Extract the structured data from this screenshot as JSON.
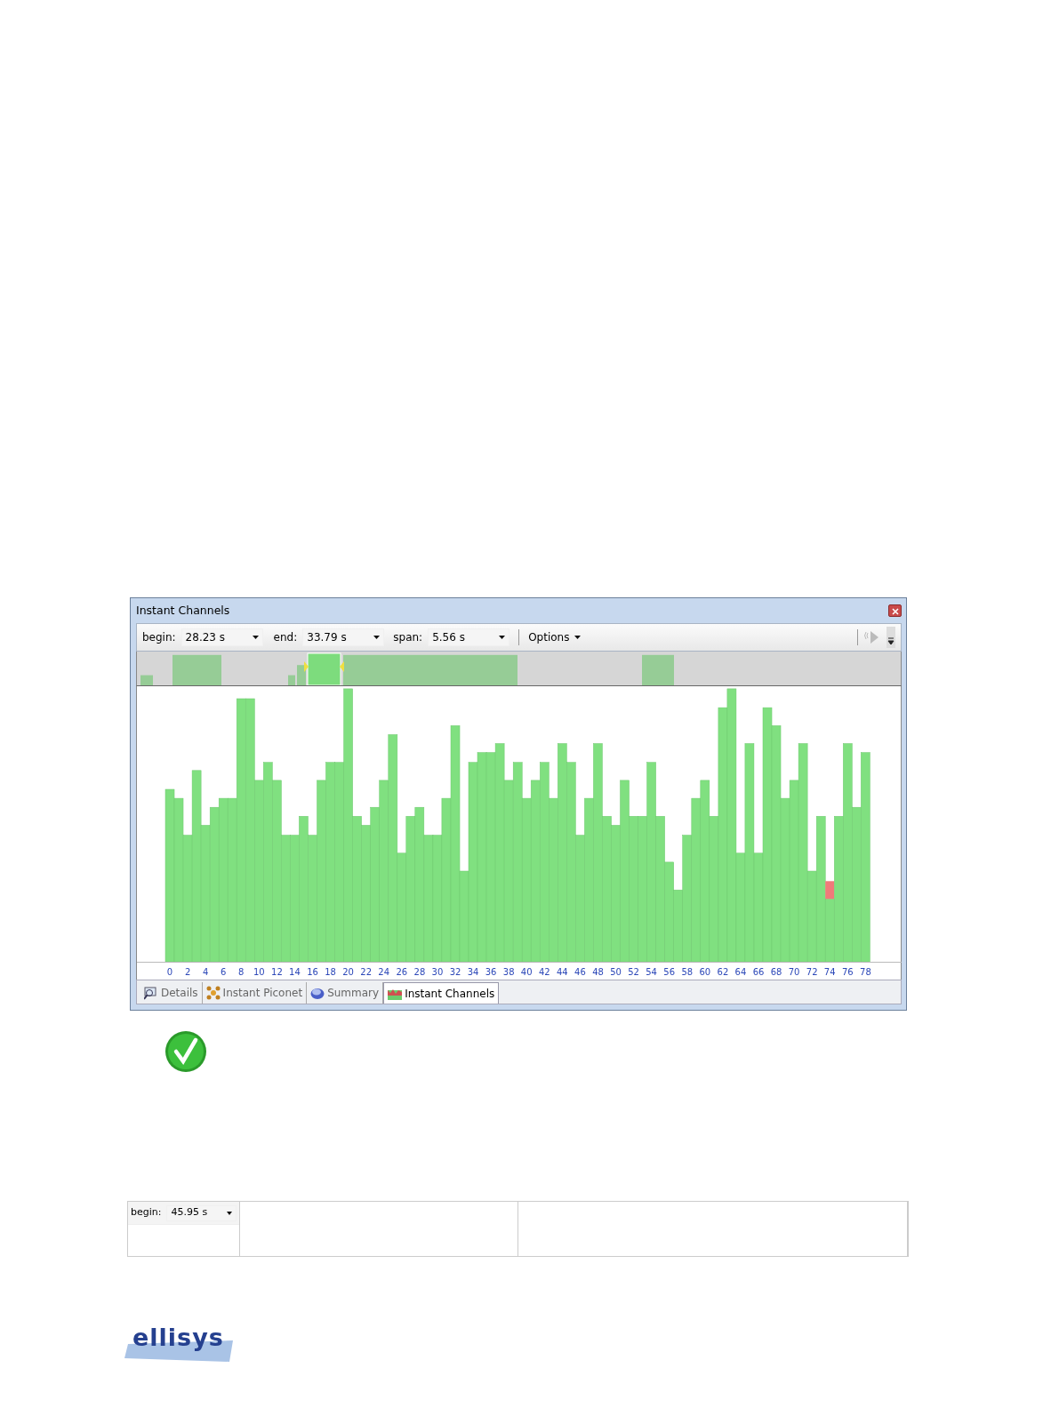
{
  "window": {
    "title": "Instant Channels"
  },
  "toolbar": {
    "fields": [
      {
        "label": "begin:",
        "value": "28.23 s"
      },
      {
        "label": "end:",
        "value": "33.79 s"
      },
      {
        "label": "span:",
        "value": "5.56 s"
      }
    ],
    "options": "Options"
  },
  "chart": {
    "channel_labels": [
      "0",
      "2",
      "4",
      "6",
      "8",
      "10",
      "12",
      "14",
      "16",
      "18",
      "20",
      "22",
      "24",
      "26",
      "28",
      "30",
      "32",
      "34",
      "36",
      "38",
      "40",
      "42",
      "44",
      "46",
      "48",
      "50",
      "52",
      "54",
      "56",
      "58",
      "60",
      "62",
      "64",
      "66",
      "68",
      "70",
      "72",
      "74",
      "76",
      "78"
    ]
  },
  "tabs": [
    {
      "label": "Details",
      "selected": false
    },
    {
      "label": "Instant Piconet",
      "selected": false
    },
    {
      "label": "Summary",
      "selected": false
    },
    {
      "label": "Instant Channels",
      "selected": true
    }
  ],
  "bottom_table": {
    "field": {
      "label": "begin:",
      "value": "45.95 s"
    }
  },
  "logo": {
    "text": "ellisys"
  }
}
